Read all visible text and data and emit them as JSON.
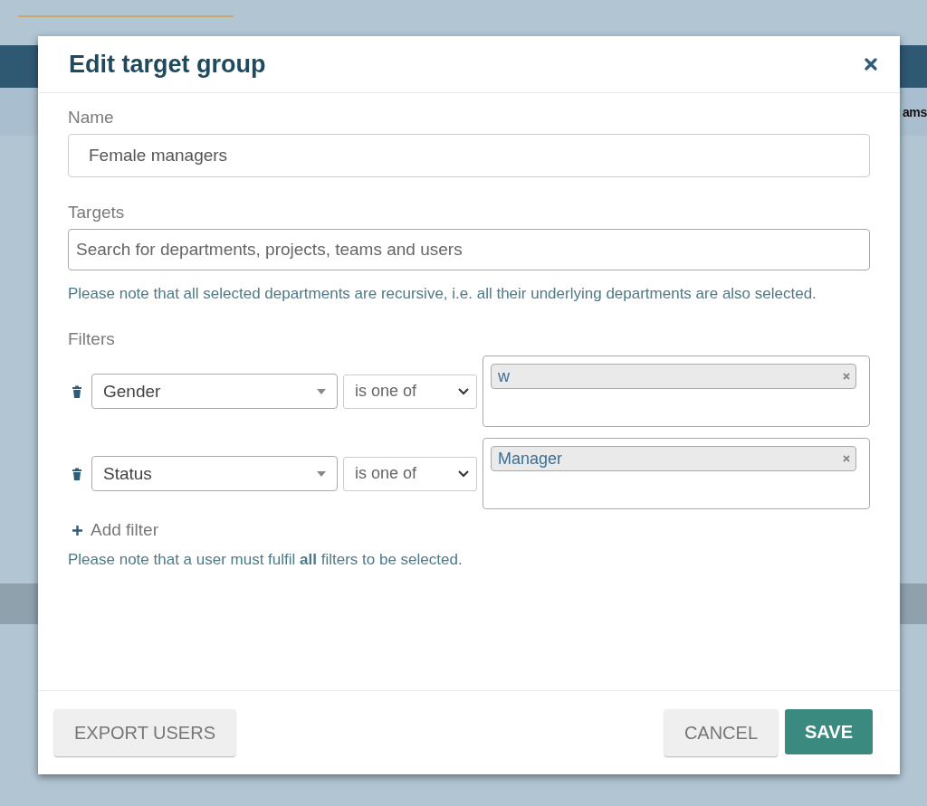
{
  "background": {
    "column_label": "ams"
  },
  "dialog": {
    "title": "Edit target group",
    "name_field": {
      "label": "Name",
      "value": "Female managers"
    },
    "targets_field": {
      "label": "Targets",
      "placeholder": "Search for departments, projects, teams and users",
      "note": "Please note that all selected departments are recursive, i.e. all their underlying departments are also selected."
    },
    "filters": {
      "label": "Filters",
      "rows": [
        {
          "attribute": "Gender",
          "operator": "is one of",
          "values": [
            "w"
          ]
        },
        {
          "attribute": "Status",
          "operator": "is one of",
          "values": [
            "Manager"
          ]
        }
      ],
      "add_label": "Add filter",
      "note": "Please note that a user must fulfil **all** filters to be selected."
    },
    "footer": {
      "left_buttons": [
        {
          "label": "EXPORT USERS",
          "kind": "secondary"
        }
      ],
      "right_buttons": [
        {
          "label": "CANCEL",
          "kind": "secondary"
        },
        {
          "label": "SAVE",
          "kind": "primary"
        }
      ]
    }
  }
}
